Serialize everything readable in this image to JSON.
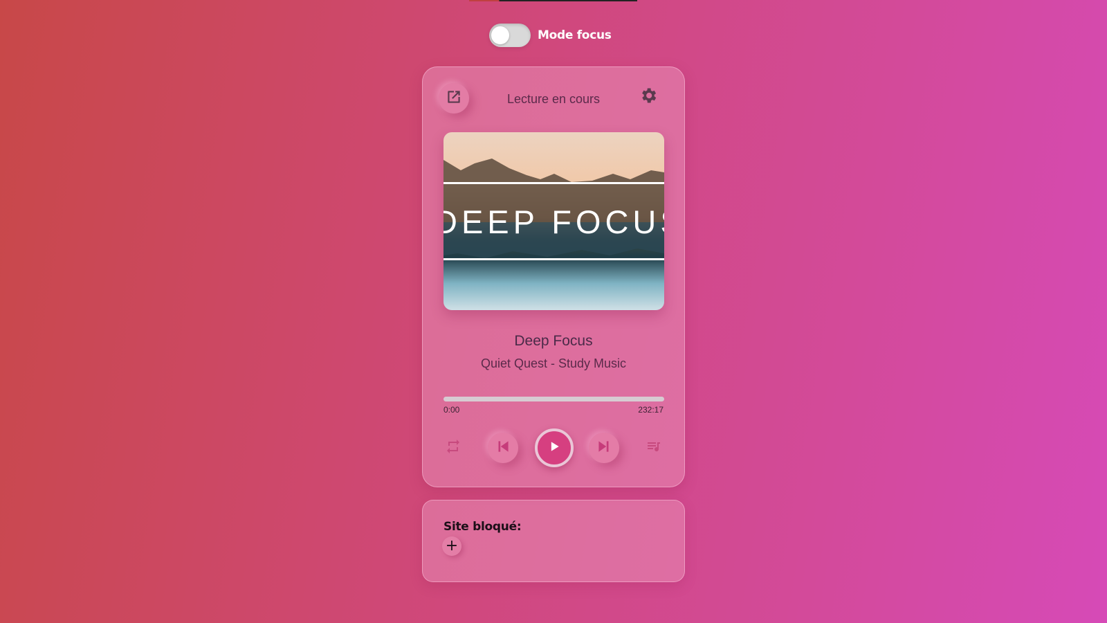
{
  "focus_toggle": {
    "label": "Mode focus",
    "on": false
  },
  "player": {
    "header_title": "Lecture en cours",
    "open_icon": "open-external-icon",
    "settings_icon": "gear-icon",
    "cover_text": "DEEP FOCUS",
    "track_title": "Deep Focus",
    "track_artist": "Quiet Quest - Study Music",
    "progress": {
      "current": "0:00",
      "total": "232:17",
      "fraction": 0.0
    },
    "controls": {
      "repeat_icon": "repeat-icon",
      "previous_icon": "skip-previous-icon",
      "play_icon": "play-icon",
      "next_icon": "skip-next-icon",
      "queue_icon": "queue-music-icon"
    },
    "colors": {
      "accent": "#d63f80",
      "icon_dark": "#5a3a4e"
    }
  },
  "blocked_sites": {
    "title": "Site bloqué:",
    "add_label": "+"
  }
}
